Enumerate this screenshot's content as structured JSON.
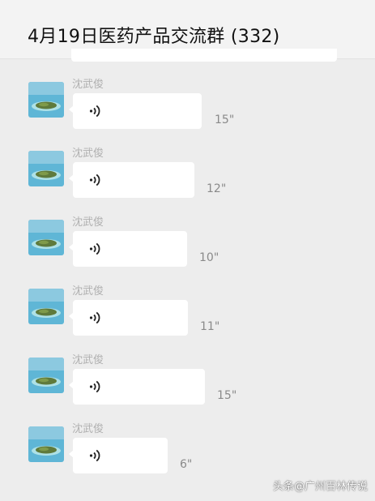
{
  "chat": {
    "title": "4月19日医药产品交流群 (332)"
  },
  "messages": [
    {
      "sender": "沈武俊",
      "type": "voice",
      "duration": "15\""
    },
    {
      "sender": "沈武俊",
      "type": "voice",
      "duration": "12\""
    },
    {
      "sender": "沈武俊",
      "type": "voice",
      "duration": "10\""
    },
    {
      "sender": "沈武俊",
      "type": "voice",
      "duration": "11\""
    },
    {
      "sender": "沈武俊",
      "type": "voice",
      "duration": "15\""
    },
    {
      "sender": "沈武俊",
      "type": "voice",
      "duration": "6\""
    }
  ],
  "icons": {
    "voice": "voice-wave-icon",
    "avatar": "island-avatar"
  },
  "colors": {
    "background": "#ededed",
    "bubble": "#ffffff",
    "sender_name": "#b0b0b0",
    "duration": "#8a8a8a"
  },
  "watermark": "头条@广州百林传说"
}
